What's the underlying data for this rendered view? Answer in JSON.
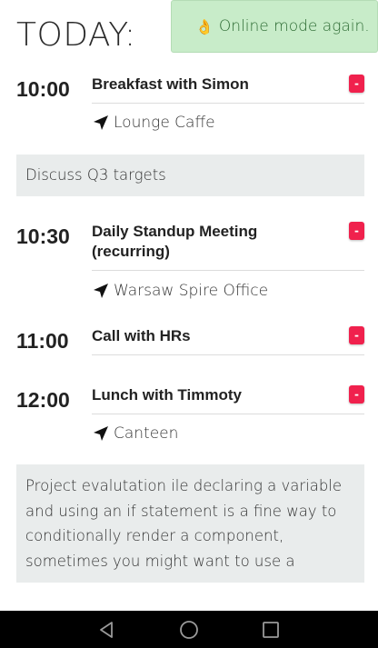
{
  "header": {
    "title": "TODAY:"
  },
  "toast": {
    "icon": "ok-hand-icon",
    "text": "Online mode again."
  },
  "events": [
    {
      "time": "10:00",
      "title": "Breakfast with Simon",
      "location": "Lounge Caffe",
      "delete_label": "-"
    },
    {
      "time": "10:30",
      "title_lines": [
        "Daily Standup Meeting",
        "(recurring)"
      ],
      "location": "Warsaw Spire Office",
      "delete_label": "-"
    },
    {
      "time": "11:00",
      "title": "Call with HRs",
      "delete_label": "-"
    },
    {
      "time": "12:00",
      "title": "Lunch with Timmoty",
      "location": "Canteen",
      "delete_label": "-"
    }
  ],
  "notes": {
    "q3": "Discuss Q3 targets",
    "project_lines": [
      "Project evalutation ile declaring a variable",
      "and using an if statement is a fine way to",
      "conditionally render a component,",
      "sometimes you might want to use a"
    ]
  },
  "colors": {
    "accent_delete": "#f0214d",
    "toast_bg": "#c8ecc9",
    "note_bg": "#e9ecec"
  },
  "navbar": {
    "back": "back-icon",
    "home": "home-icon",
    "recents": "recents-icon"
  }
}
